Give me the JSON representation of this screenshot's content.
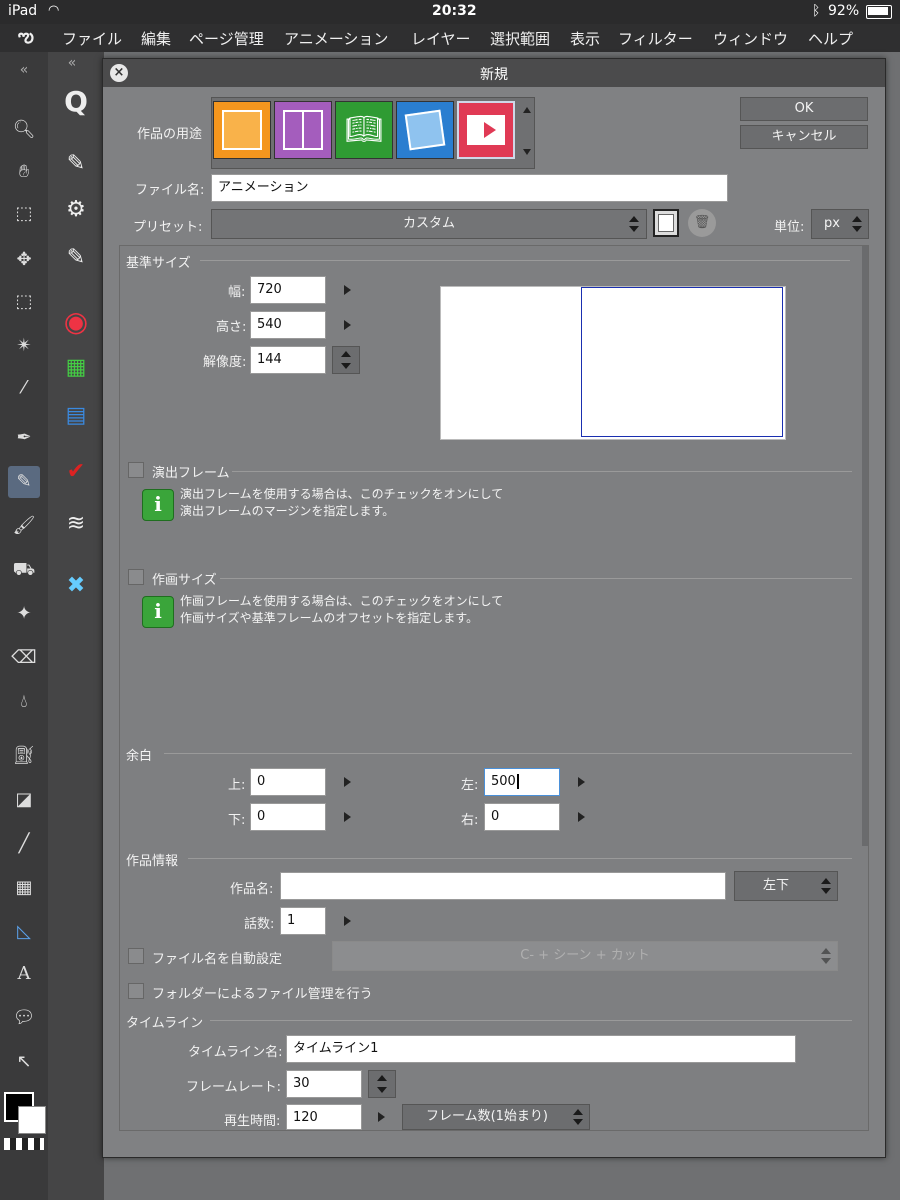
{
  "status_bar": {
    "device": "iPad",
    "time": "20:32",
    "battery": "92%"
  },
  "menu": [
    "ファイル",
    "編集",
    "ページ管理",
    "アニメーション",
    "レイヤー",
    "選択範囲",
    "表示",
    "フィルター",
    "ウィンドウ",
    "ヘルプ"
  ],
  "dialog": {
    "title": "新規",
    "ok": "OK",
    "cancel": "キャンセル",
    "purpose_label": "作品の用途",
    "filename_label": "ファイル名:",
    "filename_value": "アニメーション",
    "preset_label": "プリセット:",
    "preset_value": "カスタム",
    "unit_label": "単位:",
    "unit_value": "px",
    "base_size": {
      "section": "基準サイズ",
      "width_label": "幅:",
      "width": "720",
      "height_label": "高さ:",
      "height": "540",
      "resolution_label": "解像度:",
      "resolution": "144"
    },
    "staging_frame": {
      "label": "演出フレーム",
      "info": [
        "演出フレームを使用する場合は、このチェックをオンにして",
        "演出フレームのマージンを指定します。"
      ]
    },
    "drawing_size": {
      "label": "作画サイズ",
      "info": [
        "作画フレームを使用する場合は、このチェックをオンにして",
        "作画サイズや基準フレームのオフセットを指定します。"
      ]
    },
    "margin": {
      "section": "余白",
      "top_label": "上:",
      "top": "0",
      "bottom_label": "下:",
      "bottom": "0",
      "left_label": "左:",
      "left": "500",
      "right_label": "右:",
      "right": "0"
    },
    "work_info": {
      "section": "作品情報",
      "title_label": "作品名:",
      "title_value": "",
      "position_value": "左下",
      "episode_label": "話数:",
      "episode": "1",
      "auto_filename_label": "ファイル名を自動設定",
      "auto_filename_value": "C- + シーン + カット",
      "folder_manage_label": "フォルダーによるファイル管理を行う"
    },
    "timeline": {
      "section": "タイムライン",
      "name_label": "タイムライン名:",
      "name": "タイムライン1",
      "framerate_label": "フレームレート:",
      "framerate": "30",
      "duration_label": "再生時間:",
      "duration": "120",
      "duration_unit": "フレーム数(1始まり)"
    }
  },
  "colors": {
    "accent_blue": "#1a2fb0",
    "info_green": "#3aa53a"
  }
}
